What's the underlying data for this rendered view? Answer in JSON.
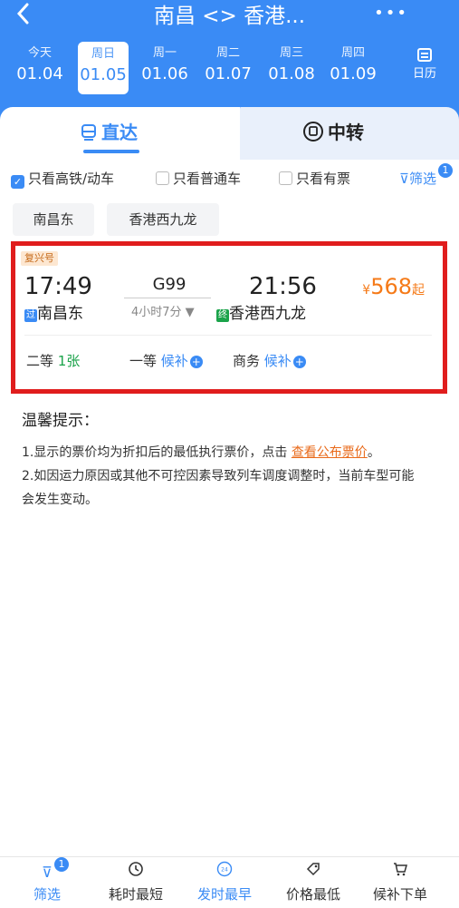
{
  "nav": {
    "title": "南昌 <> 香港...",
    "more": "•••"
  },
  "dates": [
    {
      "weekday": "今天",
      "date": "01.04"
    },
    {
      "weekday": "周日",
      "date": "01.05"
    },
    {
      "weekday": "周一",
      "date": "01.06"
    },
    {
      "weekday": "周二",
      "date": "01.07"
    },
    {
      "weekday": "周三",
      "date": "01.08"
    },
    {
      "weekday": "周四",
      "date": "01.09"
    }
  ],
  "calendar_label": "日历",
  "tabs": {
    "direct": "直达",
    "transfer": "中转"
  },
  "filters": {
    "high_speed": "只看高铁/动车",
    "normal": "只看普通车",
    "available": "只看有票",
    "screen": "筛选",
    "screen_badge": "1"
  },
  "stations": [
    "南昌东",
    "香港西九龙"
  ],
  "train": {
    "tag": "复兴号",
    "depart_time": "17:49",
    "train_no": "G99",
    "duration": "4小时7分 ▼",
    "arrive_time": "21:56",
    "price_symbol": "¥",
    "price": "568",
    "price_suffix": "起",
    "from_mark": "过",
    "from_station": "南昌东",
    "to_mark": "终",
    "to_station": "香港西九龙",
    "seats": [
      {
        "name": "二等",
        "status": "1张"
      },
      {
        "name": "一等",
        "status": "候补"
      },
      {
        "name": "商务",
        "status": "候补"
      }
    ]
  },
  "tips": {
    "title": "温馨提示：",
    "line1": "1.显示的票价均为折扣后的最低执行票价，点击",
    "link": "查看公布票价",
    "line1_end": "。",
    "line2": "2.如因运力原因或其他不可控因素导致列车调度调整时，当前车型可能会发生变动。"
  },
  "bottom": [
    {
      "label": "筛选",
      "badge": "1"
    },
    {
      "label": "耗时最短"
    },
    {
      "label": "发时最早"
    },
    {
      "label": "价格最低"
    },
    {
      "label": "候补下单"
    }
  ],
  "colors": {
    "primary": "#3a8bf5",
    "price": "#f57a18",
    "highlight": "#e01d1d",
    "available": "#1aa34a"
  }
}
